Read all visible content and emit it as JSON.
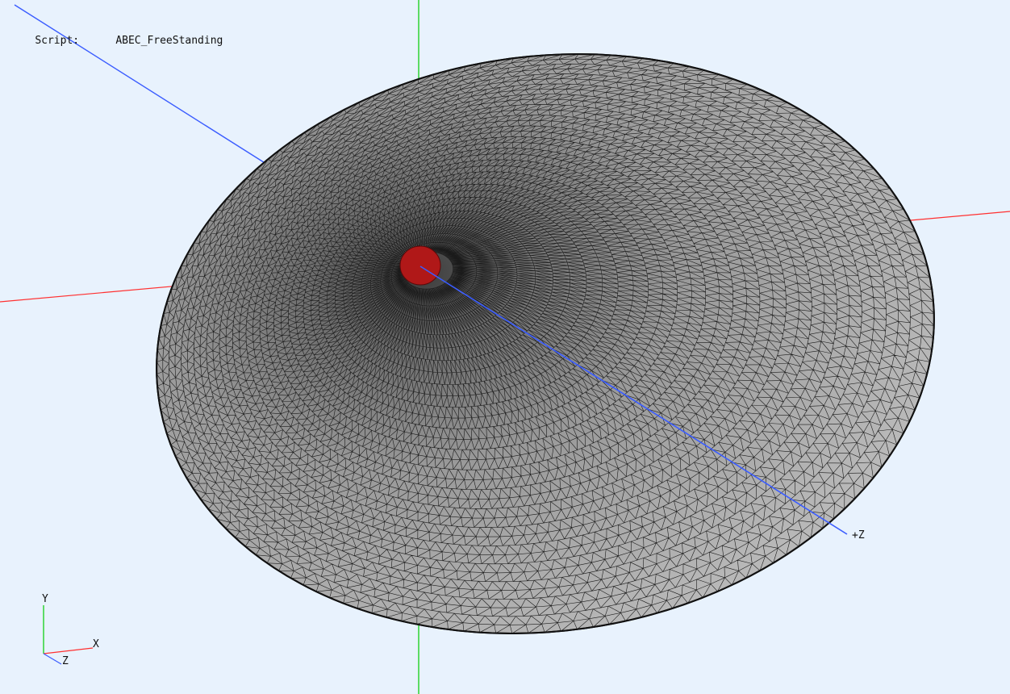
{
  "viewport": {
    "script_label": "Script:",
    "script_name": "ABEC_FreeStanding",
    "axis_label_z_main": "+Z"
  },
  "triad": {
    "x_label": "X",
    "y_label": "Y",
    "z_label": "Z"
  },
  "colors": {
    "background": "#e8f2fd",
    "x_axis": "#ff3030",
    "y_axis": "#00cc00",
    "z_axis": "#3a5cff",
    "mesh_fill": "#b5b5b5",
    "mesh_lines": "#1a1a1a",
    "source_patch": "#b01818"
  }
}
